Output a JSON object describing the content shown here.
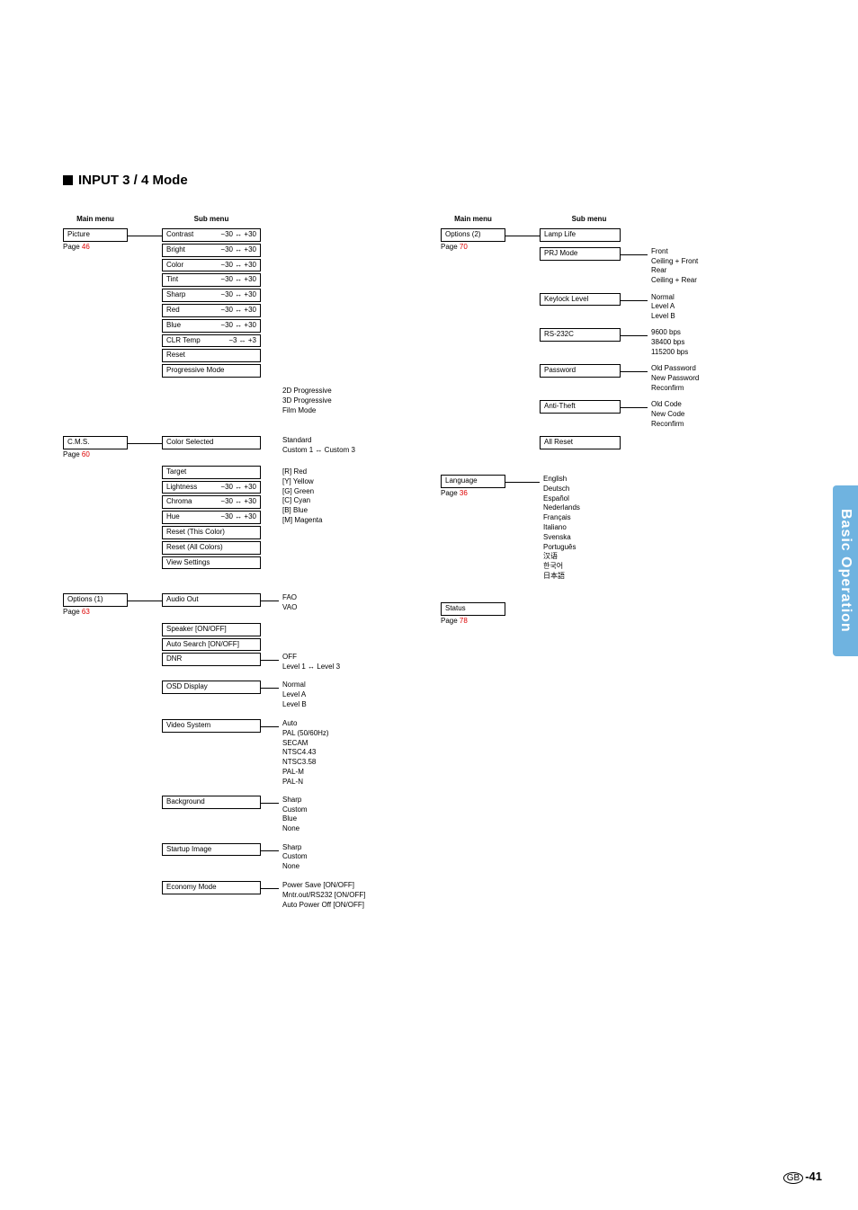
{
  "heading": "INPUT 3 / 4 Mode",
  "side_tab": "Basic Operation",
  "footer_region": "GB",
  "footer_page": "-41",
  "headers": {
    "main": "Main menu",
    "sub": "Sub menu"
  },
  "left": {
    "picture": {
      "title": "Picture",
      "page": "46",
      "items": [
        {
          "label": "Contrast",
          "range": "−30 ↔ +30"
        },
        {
          "label": "Bright",
          "range": "−30 ↔ +30"
        },
        {
          "label": "Color",
          "range": "−30 ↔ +30"
        },
        {
          "label": "Tint",
          "range": "−30 ↔ +30"
        },
        {
          "label": "Sharp",
          "range": "−30 ↔ +30"
        },
        {
          "label": "Red",
          "range": "−30 ↔ +30"
        },
        {
          "label": "Blue",
          "range": "−30 ↔ +30"
        },
        {
          "label": "CLR Temp",
          "range": "−3 ↔ +3"
        },
        {
          "label": "Reset",
          "range": ""
        },
        {
          "label": "Progressive Mode",
          "range": ""
        }
      ],
      "progressive_leaves": [
        "2D Progressive",
        "3D Progressive",
        "Film Mode"
      ]
    },
    "cms": {
      "title": "C.M.S.",
      "page": "60",
      "items": [
        {
          "label": "Color Selected"
        },
        {
          "label": "Target"
        },
        {
          "label": "Lightness",
          "range": "−30 ↔ +30"
        },
        {
          "label": "Chroma",
          "range": "−30 ↔ +30"
        },
        {
          "label": "Hue",
          "range": "−30 ↔ +30"
        },
        {
          "label": "Reset (This Color)"
        },
        {
          "label": "Reset (All Colors)"
        },
        {
          "label": "View Settings"
        }
      ],
      "color_selected_leaves": [
        "Standard",
        "Custom 1 ↔ Custom 3"
      ],
      "target_leaves": [
        "[R] Red",
        "[Y] Yellow",
        "[G] Green",
        "[C] Cyan",
        "[B] Blue",
        "[M] Magenta"
      ]
    },
    "options1": {
      "title": "Options (1)",
      "page": "63",
      "items": [
        {
          "label": "Audio Out",
          "leaves": [
            "FAO",
            "VAO"
          ]
        },
        {
          "label": "Speaker [ON/OFF]"
        },
        {
          "label": "Auto Search [ON/OFF]"
        },
        {
          "label": "DNR",
          "leaves": [
            "OFF",
            "Level 1 ↔ Level 3"
          ]
        },
        {
          "label": "OSD Display",
          "leaves": [
            "Normal",
            "Level A",
            "Level B"
          ]
        },
        {
          "label": "Video System",
          "leaves": [
            "Auto",
            "PAL (50/60Hz)",
            "SECAM",
            "NTSC4.43",
            "NTSC3.58",
            "PAL-M",
            "PAL-N"
          ]
        },
        {
          "label": "Background",
          "leaves": [
            "Sharp",
            "Custom",
            "Blue",
            "None"
          ]
        },
        {
          "label": "Startup Image",
          "leaves": [
            "Sharp",
            "Custom",
            "None"
          ]
        },
        {
          "label": "Economy Mode",
          "leaves": [
            "Power Save [ON/OFF]",
            "Mntr.out/RS232 [ON/OFF]",
            "Auto Power Off [ON/OFF]"
          ]
        }
      ]
    }
  },
  "right": {
    "options2": {
      "title": "Options (2)",
      "page": "70",
      "items": [
        {
          "label": "Lamp Life"
        },
        {
          "label": "PRJ Mode",
          "leaves": [
            "Front",
            "Ceiling + Front",
            "Rear",
            "Ceiling + Rear"
          ]
        },
        {
          "label": "Keylock Level",
          "leaves": [
            "Normal",
            "Level A",
            "Level B"
          ]
        },
        {
          "label": "RS-232C",
          "leaves": [
            "9600 bps",
            "38400 bps",
            "115200 bps"
          ]
        },
        {
          "label": "Password",
          "leaves": [
            "Old Password",
            "New Password",
            "Reconfirm"
          ]
        },
        {
          "label": "Anti-Theft",
          "leaves": [
            "Old Code",
            "New Code",
            "Reconfirm"
          ]
        },
        {
          "label": "All Reset"
        }
      ]
    },
    "language": {
      "title": "Language",
      "page": "36",
      "leaves": [
        "English",
        "Deutsch",
        "Español",
        "Nederlands",
        "Français",
        "Italiano",
        "Svenska",
        "Português",
        "汉语",
        "한국어",
        "日本語"
      ]
    },
    "status": {
      "title": "Status",
      "page": "78"
    }
  }
}
